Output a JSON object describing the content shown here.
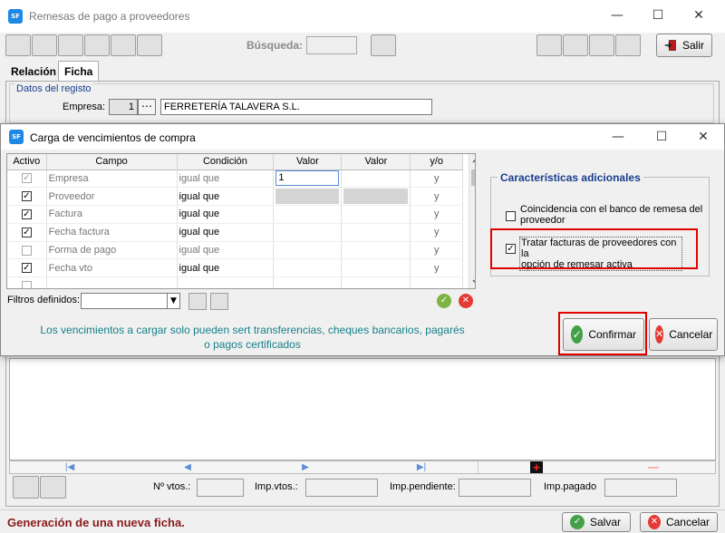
{
  "main_window": {
    "app_icon": "SF",
    "title": "Remesas de pago a proveedores",
    "controls": {
      "minimize": "—",
      "maximize": "☐",
      "close": "✕"
    }
  },
  "toolbar": {
    "search_label": "Búsqueda:",
    "exit_label": "Salir"
  },
  "tabs": [
    {
      "label": "Relación"
    },
    {
      "label": "Ficha"
    }
  ],
  "registry": {
    "group_label": "Datos del registo",
    "empresa_label": "Empresa:",
    "empresa_code": "1",
    "empresa_lookup": "⋯",
    "empresa_name": "FERRETERÍA TALAVERA S.L."
  },
  "dialog": {
    "title": "Carga de vencimientos de compra",
    "grid": {
      "columns": [
        "Activo",
        "Campo",
        "Condición",
        "Valor",
        "Valor",
        "y/o"
      ],
      "rows": [
        {
          "checked": "✓",
          "campo": "Empresa",
          "condicion": "igual que",
          "valor1": "1",
          "yo": "y"
        },
        {
          "checked": "✓",
          "campo": "Proveedor",
          "condicion": "igual que",
          "valor1": "",
          "yo": "y"
        },
        {
          "checked": "✓",
          "campo": "Factura",
          "condicion": "igual que",
          "valor1": "",
          "yo": "y"
        },
        {
          "checked": "✓",
          "campo": "Fecha factura",
          "condicion": "igual que",
          "valor1": "",
          "yo": "y"
        },
        {
          "checked": "",
          "campo": "Forma de pago",
          "condicion": "igual que",
          "valor1": "",
          "yo": "y"
        },
        {
          "checked": "✓",
          "campo": "Fecha vto",
          "condicion": "igual que",
          "valor1": "",
          "yo": "y"
        },
        {
          "checked": "",
          "campo": "",
          "condicion": "",
          "valor1": "",
          "yo": ""
        }
      ]
    },
    "filters_label": "Filtros definidos:",
    "combo_arrow": "▼",
    "accept_glyph": "✓",
    "reject_glyph": "✕",
    "info_line1": "Los vencimientos a cargar solo pueden sert transferencias, cheques bancarios, pagarés",
    "info_line2": "o pagos certificados",
    "characteristics": {
      "title": "Características adicionales",
      "option1_line1": "Coincidencia con el banco de remesa del",
      "option1_line2": "proveedor",
      "option2_line1": "Tratar facturas de proveedores con la",
      "option2_line2": "opción de remesar activa",
      "option2_check": "✓"
    },
    "confirm_label": "Confirmar",
    "cancel_label": "Cancelar"
  },
  "navigation": {
    "first": "|◀",
    "prev": "◀",
    "next": "▶",
    "last": "▶|",
    "add": "+",
    "remove": "—"
  },
  "totals": {
    "num_vtos_label": "Nº vtos.:",
    "imp_vtos_label": "Imp.vtos.:",
    "imp_pendiente_label": "Imp.pendiente:",
    "imp_pagado_label": "Imp.pagado"
  },
  "status": {
    "message": "Generación de una nueva ficha.",
    "save_label": "Salvar",
    "cancel_label": "Cancelar"
  },
  "colors": {
    "accent_blue": "#1e88e5",
    "section_label": "#1a3d8e",
    "info_text": "#17808a",
    "status_text": "#8b1a1a",
    "highlight_red": "#e00000"
  }
}
